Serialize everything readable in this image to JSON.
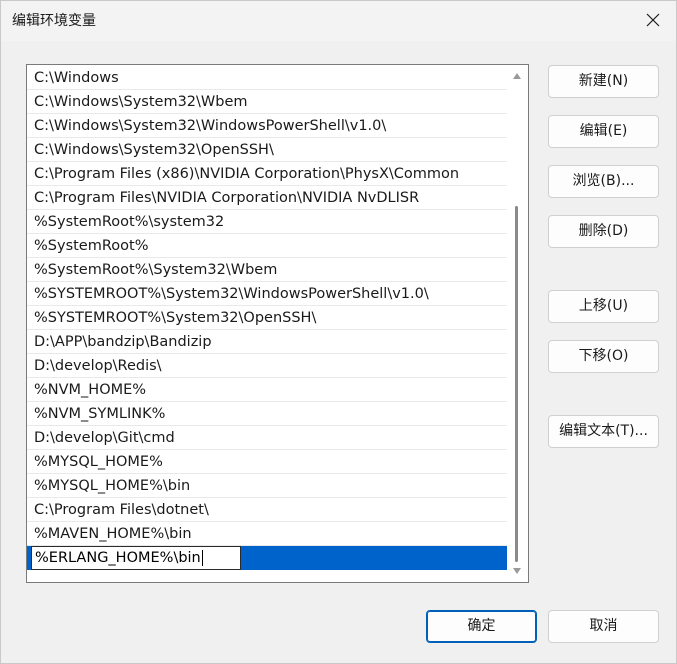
{
  "window": {
    "title": "编辑环境变量"
  },
  "list": {
    "items": [
      "C:\\Windows",
      "C:\\Windows\\System32\\Wbem",
      "C:\\Windows\\System32\\WindowsPowerShell\\v1.0\\",
      "C:\\Windows\\System32\\OpenSSH\\",
      "C:\\Program Files (x86)\\NVIDIA Corporation\\PhysX\\Common",
      "C:\\Program Files\\NVIDIA Corporation\\NVIDIA NvDLISR",
      "%SystemRoot%\\system32",
      "%SystemRoot%",
      "%SystemRoot%\\System32\\Wbem",
      "%SYSTEMROOT%\\System32\\WindowsPowerShell\\v1.0\\",
      "%SYSTEMROOT%\\System32\\OpenSSH\\",
      "D:\\APP\\bandzip\\Bandizip",
      "D:\\develop\\Redis\\",
      "%NVM_HOME%",
      "%NVM_SYMLINK%",
      "D:\\develop\\Git\\cmd",
      "%MYSQL_HOME%",
      "%MYSQL_HOME%\\bin",
      "C:\\Program Files\\dotnet\\",
      "%MAVEN_HOME%\\bin"
    ],
    "editing_value": "%ERLANG_HOME%\\bin"
  },
  "buttons": {
    "new": "新建(N)",
    "edit": "编辑(E)",
    "browse": "浏览(B)...",
    "delete": "删除(D)",
    "move_up": "上移(U)",
    "move_down": "下移(O)",
    "edit_text": "编辑文本(T)...",
    "ok": "确定",
    "cancel": "取消"
  },
  "colors": {
    "selection": "#0063cc",
    "primary_border": "#005fb8"
  }
}
